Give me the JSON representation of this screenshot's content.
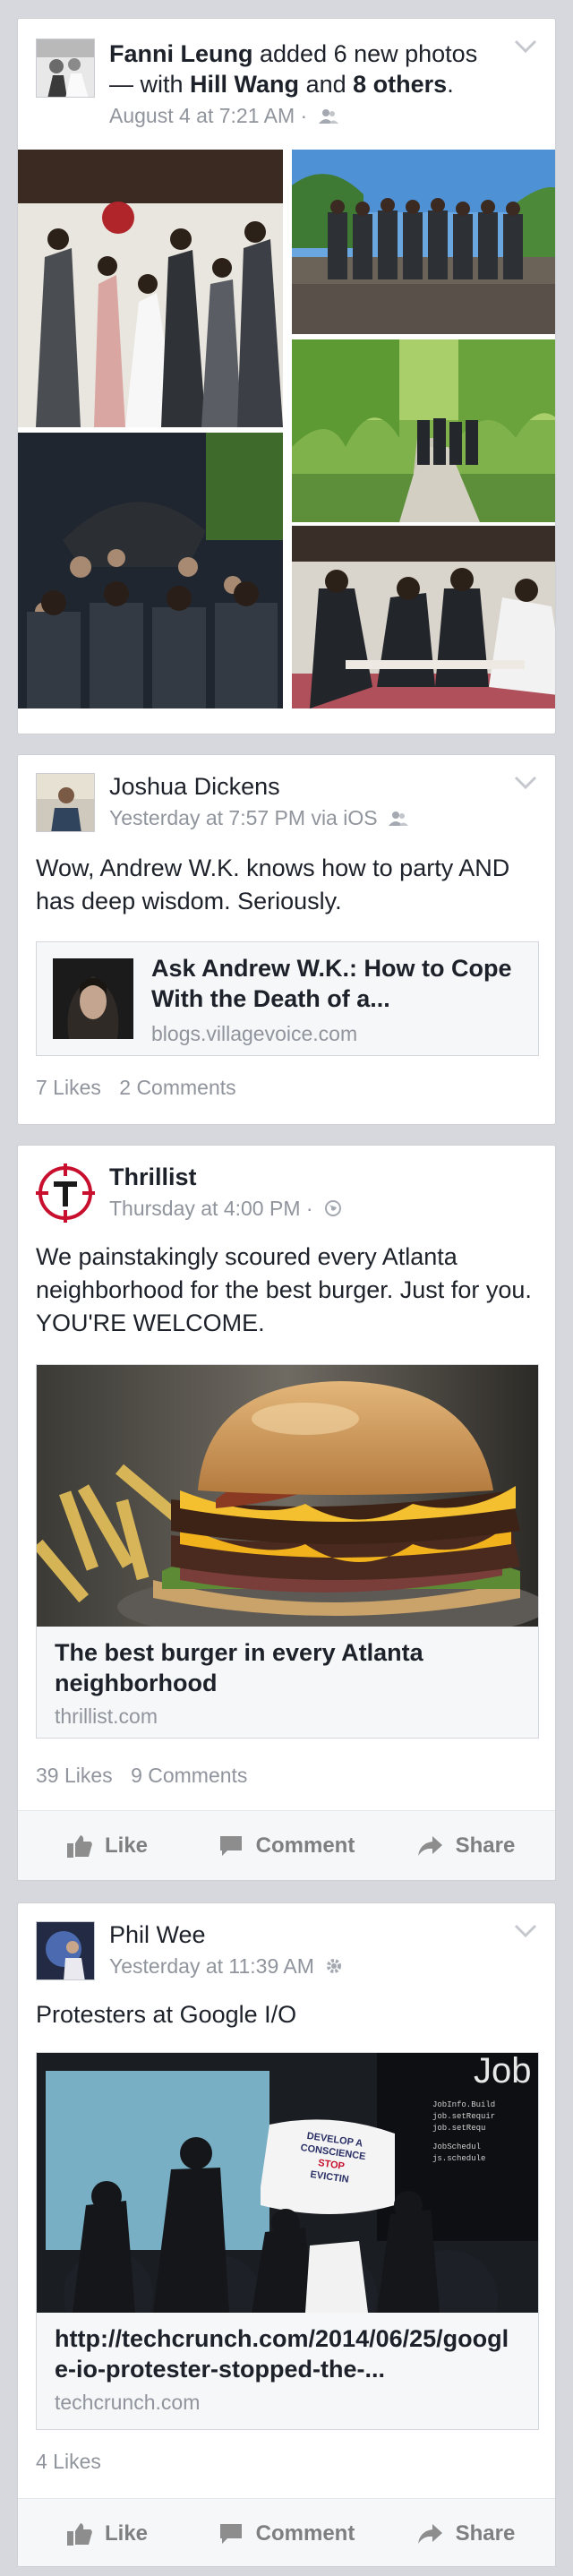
{
  "posts": [
    {
      "author": "Fanni Leung",
      "action_text": "added 6 new photos — with",
      "tag1": "Hill Wang",
      "tag_and": "and",
      "tag2": "8 others",
      "tag_end": ".",
      "time": "August 4 at 7:21 AM ·",
      "privacy_icon": "friends-icon"
    },
    {
      "author": "Joshua Dickens",
      "time": "Yesterday at 7:57 PM via iOS",
      "privacy_icon": "friends-icon",
      "text": "Wow, Andrew W.K. knows how to party AND has deep wisdom. Seriously.",
      "link_title": "Ask Andrew W.K.: How to Cope With the Death of a...",
      "link_domain": "blogs.villagevoice.com",
      "likes": "7 Likes",
      "comments": "2 Comments"
    },
    {
      "author": "Thrillist",
      "time": "Thursday at 4:00 PM ·",
      "privacy_icon": "globe-icon",
      "text": "We painstakingly scoured every Atlanta neighborhood for the best burger. Just for you. YOU'RE WELCOME.",
      "link_title": "The best burger in every Atlanta neighborhood",
      "link_domain": "thrillist.com",
      "likes": "39 Likes",
      "comments": "9 Comments"
    },
    {
      "author": "Phil Wee",
      "time": "Yesterday at 11:39 AM",
      "privacy_icon": "gear-icon",
      "text": "Protesters at Google I/O",
      "link_title": "http://techcrunch.com/2014/06/25/google-io-protester-stopped-the-...",
      "link_domain": "techcrunch.com",
      "likes": "4 Likes",
      "image_slide_text": "Job",
      "code_lines": [
        "JobInfo.Build",
        "job.setRequir",
        "job.setRequ",
        "JobSchedul",
        "js.schedule"
      ],
      "banner_lines": [
        "DEVELOP A",
        "CONSCIENCE",
        "STOP",
        "EVICTIN"
      ]
    }
  ],
  "actions": {
    "like": "Like",
    "comment": "Comment",
    "share": "Share"
  },
  "colors": {
    "background": "#d6d8dd",
    "meta_text": "#90949c",
    "action_text": "#7f7f7f",
    "thrillist_red": "#c8102e"
  }
}
